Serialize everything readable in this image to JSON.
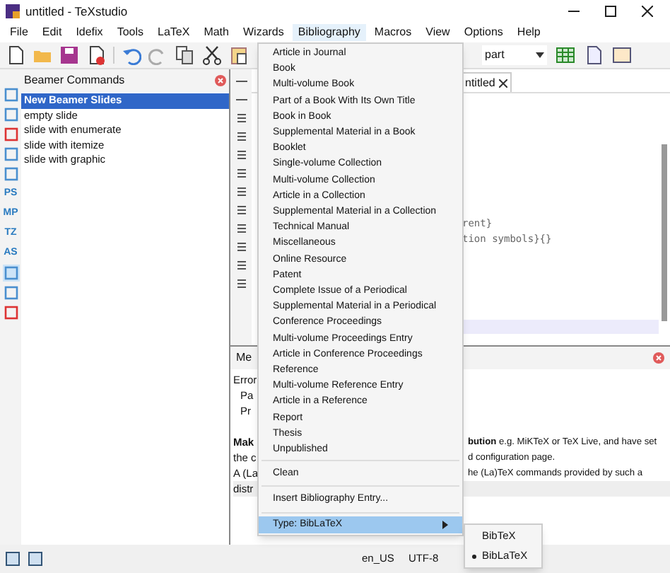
{
  "window": {
    "title": "untitled - TeXstudio"
  },
  "menu_bar": [
    {
      "label": "File",
      "selected": false
    },
    {
      "label": "Edit",
      "selected": false
    },
    {
      "label": "Idefix",
      "selected": false
    },
    {
      "label": "Tools",
      "selected": false
    },
    {
      "label": "LaTeX",
      "selected": false
    },
    {
      "label": "Math",
      "selected": false
    },
    {
      "label": "Wizards",
      "selected": false
    },
    {
      "label": "Bibliography",
      "selected": true
    },
    {
      "label": "Macros",
      "selected": false
    },
    {
      "label": "View",
      "selected": false
    },
    {
      "label": "Options",
      "selected": false
    },
    {
      "label": "Help",
      "selected": false
    }
  ],
  "toolbar": {
    "structure_combo": "part"
  },
  "side_strip": [
    {
      "kind": "icon"
    },
    {
      "kind": "icon"
    },
    {
      "kind": "icon"
    },
    {
      "kind": "icon"
    },
    {
      "kind": "icon"
    },
    {
      "kind": "text",
      "label": "PS"
    },
    {
      "kind": "text",
      "label": "MP"
    },
    {
      "kind": "text",
      "label": "TZ"
    },
    {
      "kind": "text",
      "label": "AS"
    },
    {
      "kind": "icon",
      "selected": true
    },
    {
      "kind": "icon"
    },
    {
      "kind": "icon"
    }
  ],
  "side_panel": {
    "title": "Beamer Commands",
    "items": [
      {
        "label": "New Beamer Slides",
        "selected": true
      },
      {
        "label": "empty slide",
        "selected": false
      },
      {
        "label": "slide with enumerate",
        "selected": false
      },
      {
        "label": "slide with itemize",
        "selected": false
      },
      {
        "label": "slide with graphic",
        "selected": false
      }
    ]
  },
  "editor": {
    "tab": "ntitled",
    "lines": [
      "rent}",
      "tion symbols}{}"
    ]
  },
  "messages": {
    "tab": "Me",
    "left": [
      "Error",
      "Pa",
      "Pr"
    ],
    "lines": [
      {
        "left": "Mak",
        "right": "**bution** e.g. MiKTeX or TeX Live, and have set"
      },
      {
        "left": "the c",
        "right": "d configuration page."
      },
      {
        "left": "A (La",
        "right": "he (La)TeX commands provided by such a"
      },
      {
        "left": "distr"
      }
    ]
  },
  "bibliography_menu": {
    "groups": [
      [
        "Article in Journal",
        "Book",
        "Multi-volume Book",
        "Part of a Book With Its Own Title",
        "Book in Book",
        "Supplemental Material in a Book",
        "Booklet",
        "Single-volume Collection",
        "Multi-volume Collection",
        "Article in a Collection",
        "Supplemental Material in a Collection",
        "Technical Manual",
        "Miscellaneous",
        "Online Resource",
        "Patent",
        "Complete Issue of a Periodical",
        "Supplemental Material in a Periodical",
        "Conference Proceedings",
        "Multi-volume Proceedings Entry",
        "Article in Conference Proceedings",
        "Reference",
        "Multi-volume Reference Entry",
        "Article in a Reference",
        "Report",
        "Thesis",
        "Unpublished"
      ],
      [
        "Clean"
      ],
      [
        "Insert Bibliography Entry..."
      ]
    ],
    "submenu_item": {
      "label": "Type: BibLaTeX",
      "selected": true
    }
  },
  "type_submenu": [
    {
      "label": "BibTeX",
      "selected": false
    },
    {
      "label": "BibLaTeX",
      "selected": true
    }
  ],
  "status_bar": [
    "en_US",
    "UTF-8"
  ]
}
